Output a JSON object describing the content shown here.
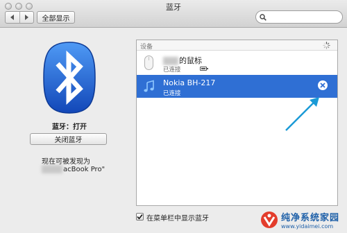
{
  "window": {
    "title": "蓝牙"
  },
  "toolbar": {
    "back_icon": "chevron-left-icon",
    "forward_icon": "chevron-right-icon",
    "show_all_label": "全部显示",
    "search_placeholder": "",
    "search_icon": "search-icon"
  },
  "status": {
    "state_label": "蓝牙：打开",
    "toggle_label": "关闭蓝牙",
    "discoverable_line1": "现在可被发现为",
    "discoverable_line2": "acBook Pro\""
  },
  "devices": {
    "header": "设备",
    "items": [
      {
        "name": "的鼠标",
        "status": "已连接",
        "icon": "mouse-icon",
        "selected": false
      },
      {
        "name": "Nokia BH-217",
        "status": "已连接",
        "icon": "music-note-icon",
        "selected": true
      }
    ]
  },
  "footer": {
    "show_in_menubar_label": "在菜单栏中显示蓝牙",
    "checked": true
  },
  "watermark": {
    "title": "纯净系统家园",
    "url": "www.yidaimei.com"
  },
  "colors": {
    "selection": "#2f6fd4",
    "arrow": "#1a9ad6"
  }
}
